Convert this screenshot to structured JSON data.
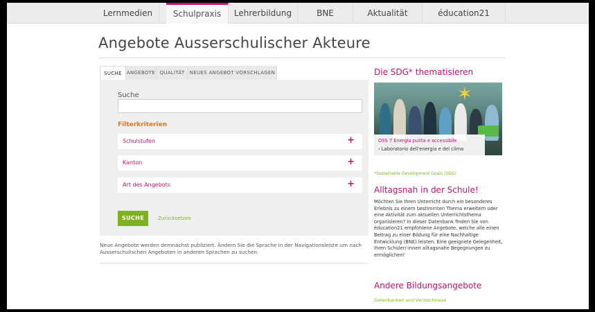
{
  "nav": {
    "tabs": [
      {
        "label": "Lernmedien"
      },
      {
        "label": "Schulpraxis"
      },
      {
        "label": "Lehrerbildung"
      },
      {
        "label": "BNE"
      },
      {
        "label": "Aktualität"
      },
      {
        "label": "éducation21"
      }
    ],
    "active_index": 1
  },
  "page": {
    "title": "Angebote Ausserschulischer Akteure"
  },
  "inner_tabs": [
    {
      "label": "SUCHE"
    },
    {
      "label": "ANGEBOTE"
    },
    {
      "label": "QUALITÄT"
    },
    {
      "label": "NEUES ANGEBOT VORSCHLAGEN"
    }
  ],
  "search": {
    "label": "Suche",
    "value": "",
    "placeholder": ""
  },
  "filters": {
    "heading": "Filterkriterien",
    "items": [
      {
        "label": "Schulstufen",
        "expand": "+"
      },
      {
        "label": "Kanton",
        "expand": "+"
      },
      {
        "label": "Art des Angebots",
        "expand": "+"
      }
    ]
  },
  "actions": {
    "submit_label": "SUCHE",
    "reset_label": "Zurücksetzen"
  },
  "note": "Neue Angebote werden demnächst publiziert. Ändern Sie die Sprache in der Navigationsleiste um nach Ausserschulischen Angeboten in anderen Sprachen zu suchen.",
  "sidebar": {
    "sdg_heading": "Die SDG* thematisieren",
    "image_caption_title": "OSS 7 Energia pulita e accessibile",
    "image_caption_link": "› Laboratorio dell'energia e del clima",
    "sdg_footnote": "*Sustainable Development Goals (SDG)",
    "alltag_heading": "Alltagsnah in der Schule!",
    "alltag_text": "Möchten Sie Ihren Unterricht durch ein besonderes Erlebnis zu einem bestimmten Thema erweitern oder eine Aktivität zum aktuellen Unterrichtsthema organisieren? In dieser Datenbank finden Sie von éducation21 empfohlene Angebote, welche alle einen Beitrag zu einer Bildung für eine Nachhaltige Entwicklung (BNE) leisten. Eine geeignete Gelegenheit, Ihren Schüler/-innen alltagsnahe Begegnungen zu ermöglichen!",
    "andere_heading": "Andere Bildungsangebote",
    "andere_link": "Datenbanken und Verzeichnisse"
  },
  "colors": {
    "accent": "#c8106e",
    "green": "#7fb31c",
    "orange": "#e0782b"
  }
}
